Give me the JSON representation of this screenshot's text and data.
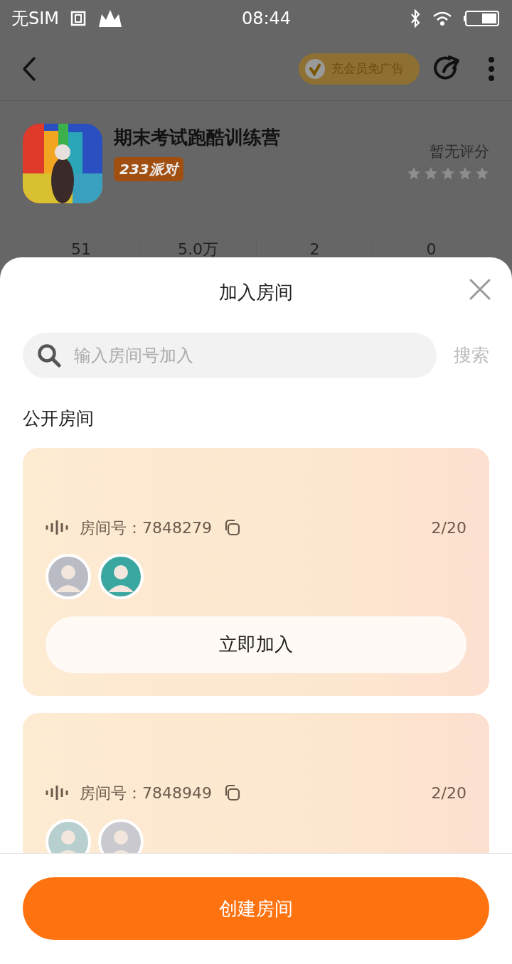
{
  "status_bar": {
    "carrier": "无SIM",
    "time": "08:44"
  },
  "nav": {
    "vip_label": "充会员免广告"
  },
  "game": {
    "title": "期末考试跑酷训练营",
    "tag": "233派对",
    "rating_label": "暂无评分",
    "stars": 0,
    "stats": [
      "51",
      "5.0万",
      "2",
      "0"
    ]
  },
  "sheet": {
    "title": "加入房间",
    "search": {
      "placeholder": "输入房间号加入",
      "button": "搜索"
    },
    "section_title": "公开房间",
    "rooms": [
      {
        "number": "房间号：7848279",
        "occupancy": "2/20",
        "avatars": [
          {
            "kind": "avatar",
            "color": "#b9bcc4"
          },
          {
            "kind": "avatar",
            "color": "#3aa6a0"
          }
        ],
        "join_label": "立即加入"
      },
      {
        "number": "房间号：7848949",
        "occupancy": "2/20",
        "avatars": [
          {
            "kind": "avatar",
            "color": "#b8cfd0"
          },
          {
            "kind": "avatar",
            "color": "#c9c9cf"
          }
        ]
      }
    ],
    "create_button": "创建房间"
  }
}
